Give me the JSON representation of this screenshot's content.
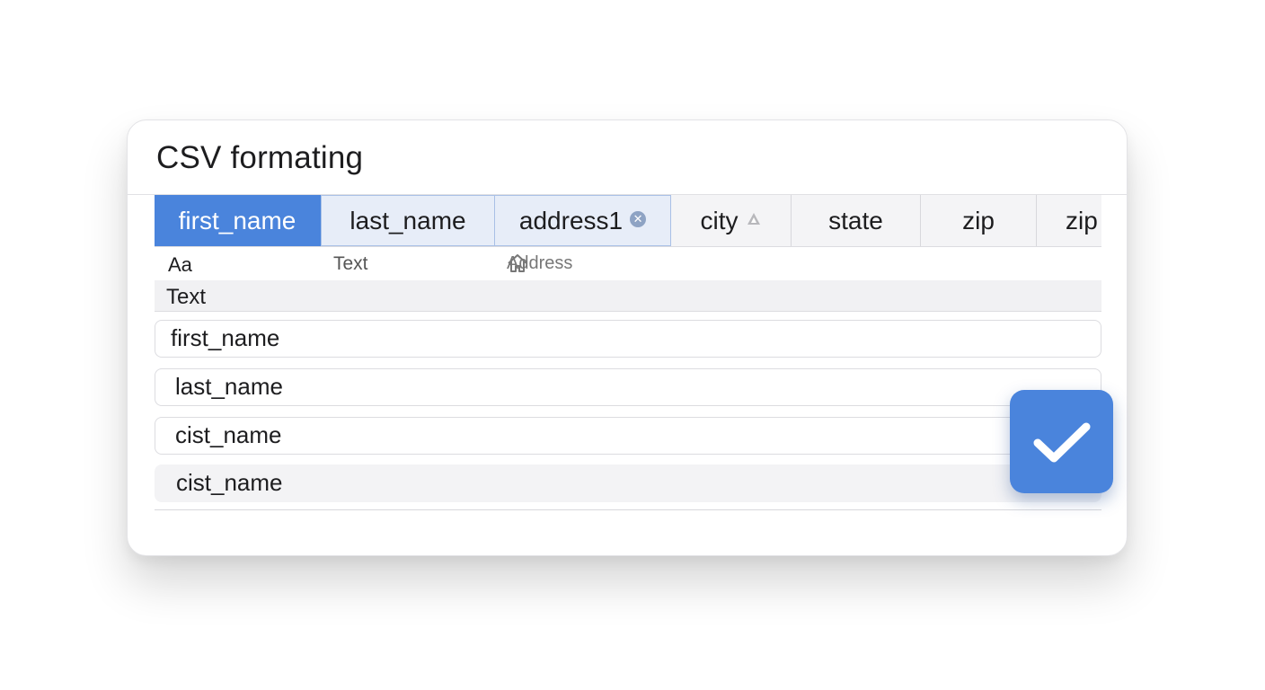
{
  "panel": {
    "title": "CSV formating"
  },
  "columns": [
    {
      "label": "first_name",
      "state": "active"
    },
    {
      "label": "last_name",
      "state": "selected"
    },
    {
      "label": "address1",
      "state": "selected",
      "icon": "close-badge-icon"
    },
    {
      "label": "city",
      "state": "normal",
      "icon": "triangle-up-icon"
    },
    {
      "label": "state",
      "state": "normal"
    },
    {
      "label": "zip",
      "state": "normal"
    },
    {
      "label": "zip",
      "state": "normal"
    }
  ],
  "type_hints": {
    "first": "Aa",
    "second": "Text",
    "third_icon": "home-icon",
    "third": "Address"
  },
  "group": {
    "label": "Text"
  },
  "fields": [
    {
      "label": "first_name"
    },
    {
      "label": "last_name"
    },
    {
      "label": "cist_name"
    },
    {
      "label": "cist_name"
    }
  ],
  "confirm": {
    "icon": "checkmark-icon",
    "color": "#4a84dc"
  },
  "colors": {
    "accent": "#4a84dc",
    "selected_bg": "#e7edf8"
  }
}
